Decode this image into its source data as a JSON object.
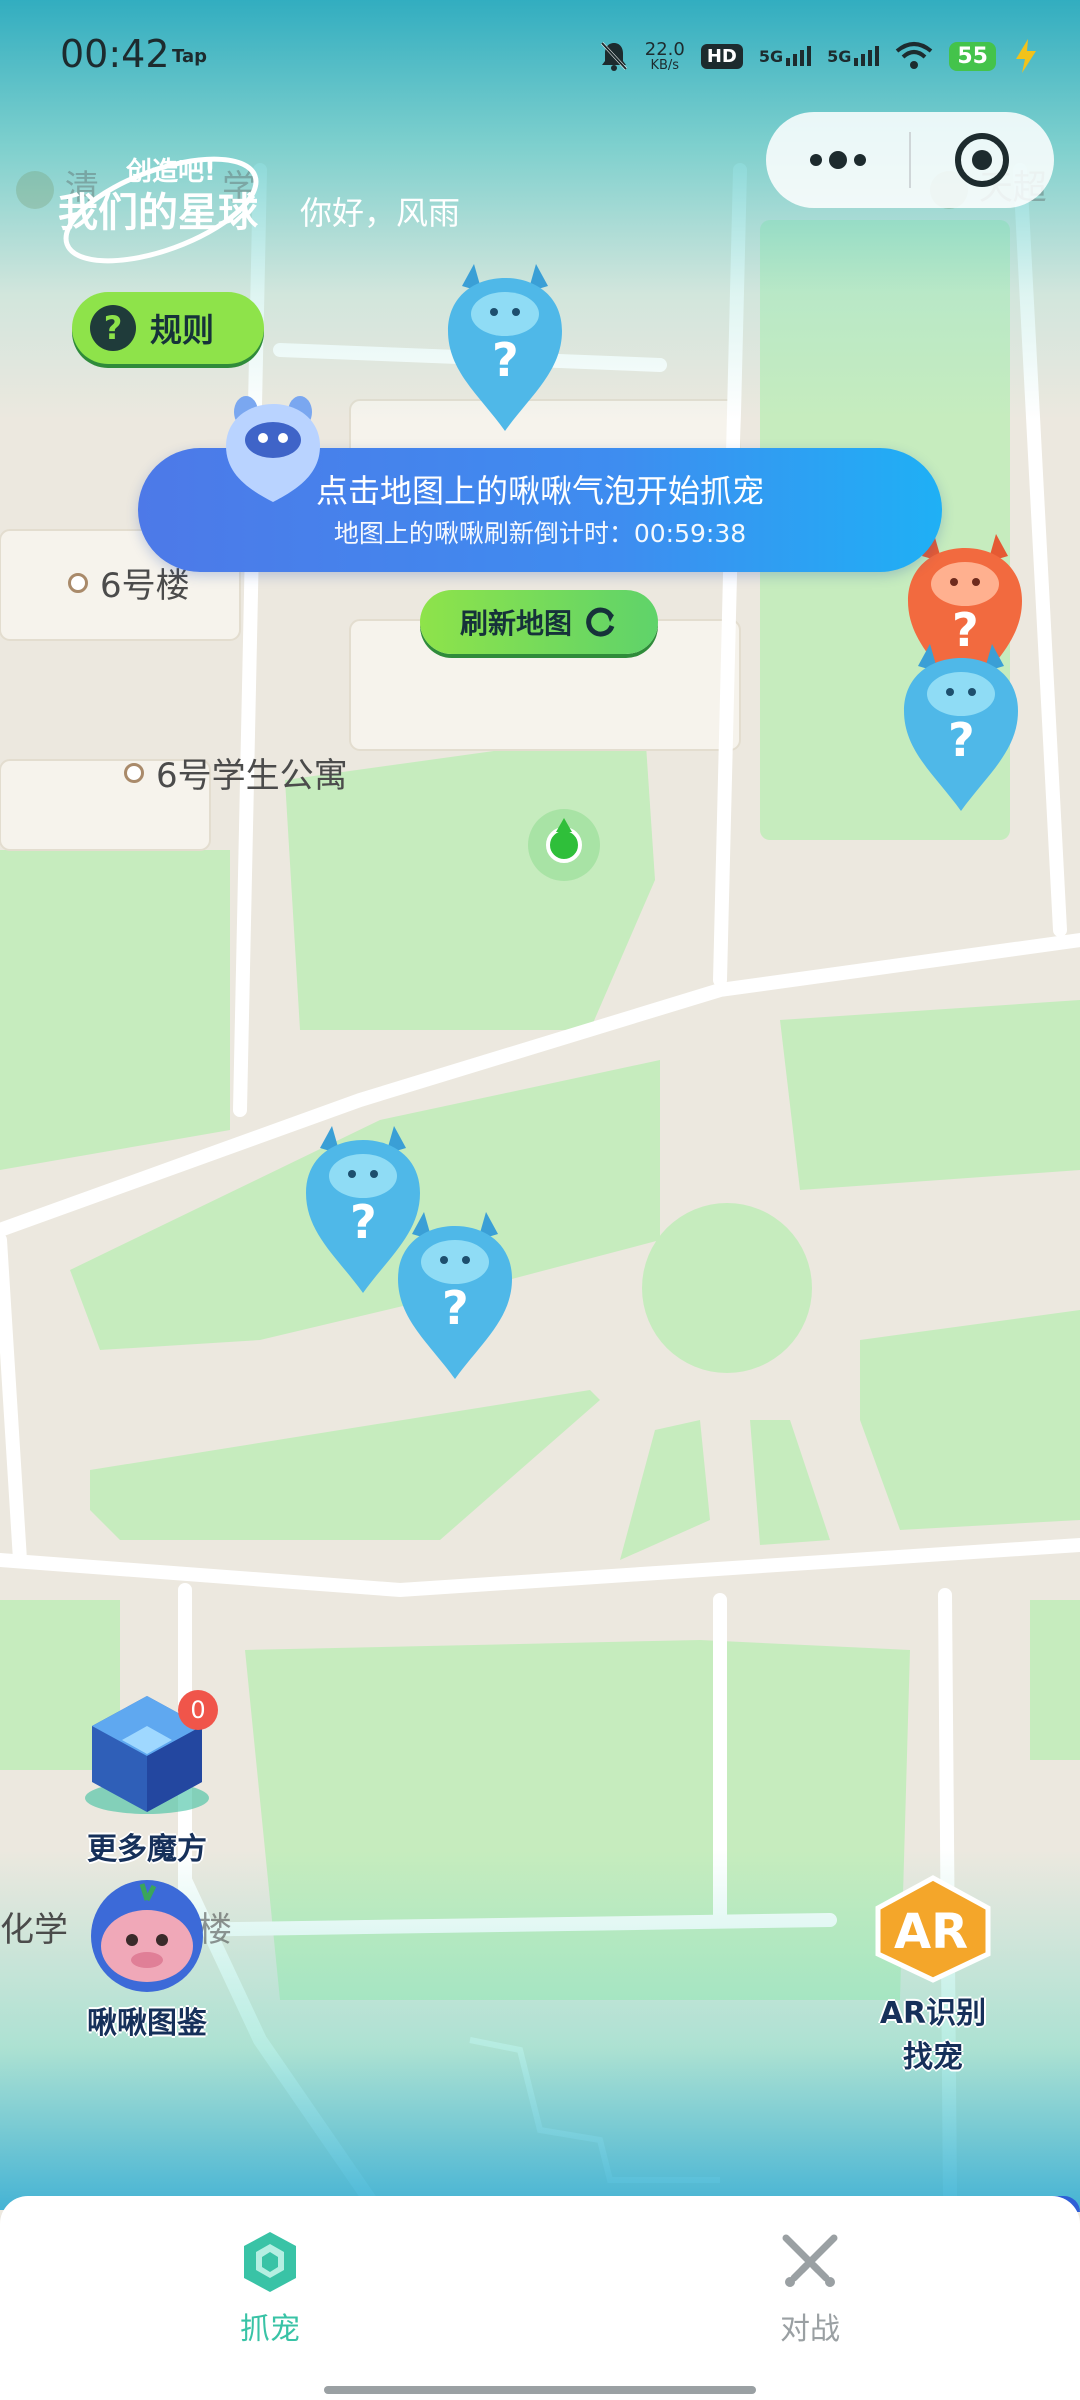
{
  "status_bar": {
    "time": "00:42",
    "tap_label": "Tap",
    "net_speed": "22.0",
    "net_unit": "KB/s",
    "hd": "HD",
    "signal_1": "5G",
    "signal_2": "5G",
    "battery": "55"
  },
  "header": {
    "logo_line1": "创造吧!",
    "logo_line2": "我们的星球",
    "greeting": "你好，风雨"
  },
  "rule_button": {
    "label": "规则"
  },
  "banner": {
    "line1": "点击地图上的啾啾气泡开始抓宠",
    "line2": "地图上的啾啾刷新倒计时：00:59:38"
  },
  "refresh_button": {
    "label": "刷新地图"
  },
  "map": {
    "labels": {
      "bldg6": "6号楼",
      "dorm6": "6号学生公寓",
      "faded_top_left": "清",
      "faded_top_left2": "学",
      "faded_top_right": "天超",
      "chem_left": "化学",
      "chem_right": "楼"
    },
    "user_location": "user-location"
  },
  "pins": [
    {
      "id": "pin-1",
      "color": "#4fb8e8",
      "mark": "?"
    },
    {
      "id": "pin-2",
      "color": "#f26a3f",
      "mark": "?"
    },
    {
      "id": "pin-3",
      "color": "#4fb8e8",
      "mark": "?"
    },
    {
      "id": "pin-4",
      "color": "#4fb8e8",
      "mark": "?"
    },
    {
      "id": "pin-5",
      "color": "#4fb8e8",
      "mark": "?"
    }
  ],
  "float_buttons": {
    "more_cube": {
      "label": "更多魔方",
      "badge": "0"
    },
    "handbook": {
      "label": "啾啾图鉴"
    },
    "ar": {
      "badge_text": "AR",
      "label_line1": "AR识别",
      "label_line2": "找宠"
    }
  },
  "tabs": [
    {
      "label": "抓宠",
      "icon": "cube-icon",
      "active": true
    },
    {
      "label": "对战",
      "icon": "swords-icon",
      "active": false
    }
  ],
  "colors": {
    "accent_green": "#8ee34a",
    "banner_blue": "#3e8df0",
    "active_tab": "#39c3a6",
    "inactive_tab": "#9aa0a3"
  }
}
